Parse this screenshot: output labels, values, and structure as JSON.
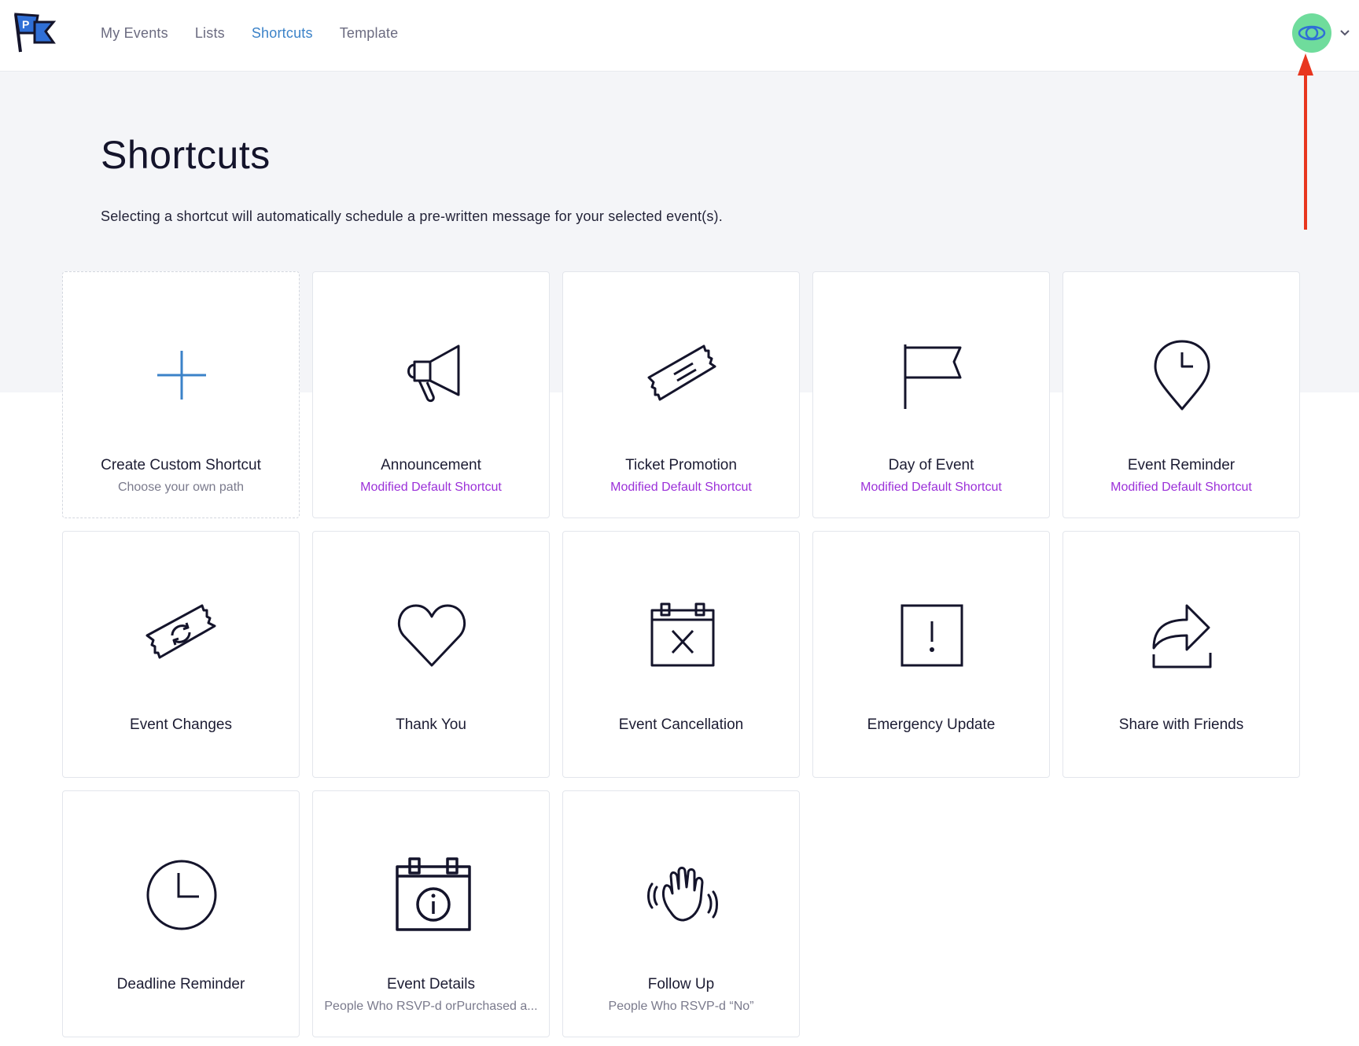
{
  "nav": {
    "items": [
      {
        "label": "My Events",
        "active": false
      },
      {
        "label": "Lists",
        "active": false
      },
      {
        "label": "Shortcuts",
        "active": true
      },
      {
        "label": "Template",
        "active": false
      }
    ]
  },
  "header": {
    "logo_icon": "flag-logo-icon",
    "avatar_icon": "eye-icon",
    "avatar_color": "#6fdc9c",
    "menu_icon": "chevron-down-icon"
  },
  "page": {
    "title": "Shortcuts",
    "description": "Selecting a shortcut will automatically schedule a pre-written message for your selected event(s)."
  },
  "cards": [
    {
      "title": "Create Custom Shortcut",
      "subtitle": "Choose your own path",
      "icon": "plus-icon"
    },
    {
      "title": "Announcement",
      "subtitle": "Modified Default Shortcut",
      "icon": "megaphone-icon"
    },
    {
      "title": "Ticket Promotion",
      "subtitle": "Modified Default Shortcut",
      "icon": "ticket-icon"
    },
    {
      "title": "Day of Event",
      "subtitle": "Modified Default Shortcut",
      "icon": "flag-icon"
    },
    {
      "title": "Event Reminder",
      "subtitle": "Modified Default Shortcut",
      "icon": "location-clock-icon"
    },
    {
      "title": "Event Changes",
      "subtitle": "",
      "icon": "ticket-refresh-icon"
    },
    {
      "title": "Thank You",
      "subtitle": "",
      "icon": "heart-icon"
    },
    {
      "title": "Event Cancellation",
      "subtitle": "",
      "icon": "calendar-x-icon"
    },
    {
      "title": "Emergency Update",
      "subtitle": "",
      "icon": "alert-box-icon"
    },
    {
      "title": "Share with Friends",
      "subtitle": "",
      "icon": "share-arrow-icon"
    },
    {
      "title": "Deadline Reminder",
      "subtitle": "",
      "icon": "clock-icon"
    },
    {
      "title": "Event Details",
      "subtitle": "People Who RSVP-d orPurchased a...",
      "icon": "calendar-info-icon"
    },
    {
      "title": "Follow Up",
      "subtitle": "People Who RSVP-d “No”",
      "icon": "waving-hand-icon"
    }
  ],
  "colors": {
    "accent": "#3b82c8",
    "modified": "#9b30d9",
    "annotation": "#e8361f"
  }
}
